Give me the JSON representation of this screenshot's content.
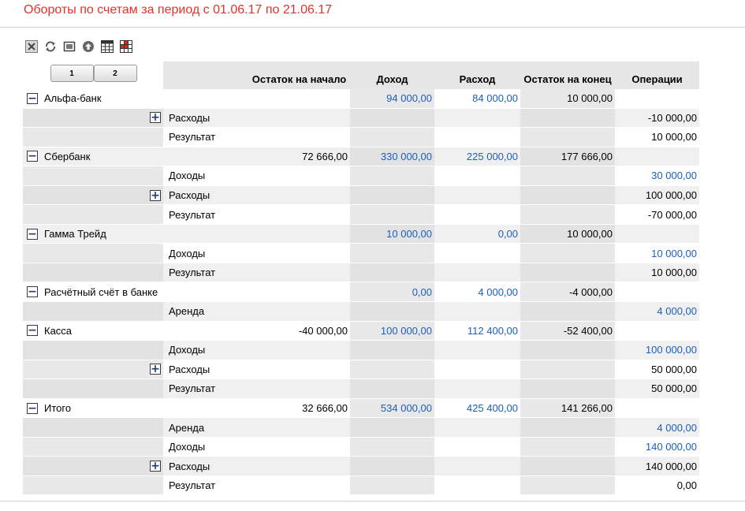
{
  "title": "Обороты по счетам за период с 01.06.17 по 21.06.17",
  "toolbar": [
    "close-icon",
    "refresh-icon",
    "fit-icon",
    "upload-icon",
    "table-icon",
    "table-red-icon"
  ],
  "colors": {
    "title": "#e2322b",
    "link": "#1b5fbf",
    "header_bg": "#e6e6e6",
    "row_shade": "#f0f0f0",
    "col_shade": "#e8e8e8"
  },
  "levels": [
    "1",
    "2"
  ],
  "headers": [
    "Остаток на начало",
    "Доход",
    "Расход",
    "Остаток на конец",
    "Операции"
  ],
  "rows": [
    {
      "group": "Альфа-банк",
      "sub": "",
      "toggle": "−",
      "c1": "",
      "c2": "94 000,00",
      "c3": "84 000,00",
      "c4": "10 000,00",
      "c5": ""
    },
    {
      "group": "",
      "sub": "Расходы",
      "toggle": "+",
      "c1": "",
      "c2": "",
      "c3": "",
      "c4": "",
      "c5": "-10 000,00"
    },
    {
      "group": "",
      "sub": "Результат",
      "toggle": "",
      "c1": "",
      "c2": "",
      "c3": "",
      "c4": "",
      "c5": "10 000,00"
    },
    {
      "group": "Сбербанк",
      "sub": "",
      "toggle": "−",
      "c1": "72 666,00",
      "c2": "330 000,00",
      "c3": "225 000,00",
      "c4": "177 666,00",
      "c5": ""
    },
    {
      "group": "",
      "sub": "Доходы",
      "toggle": "",
      "c1": "",
      "c2": "",
      "c3": "",
      "c4": "",
      "c5": "30 000,00"
    },
    {
      "group": "",
      "sub": "Расходы",
      "toggle": "+",
      "c1": "",
      "c2": "",
      "c3": "",
      "c4": "",
      "c5": "100 000,00"
    },
    {
      "group": "",
      "sub": "Результат",
      "toggle": "",
      "c1": "",
      "c2": "",
      "c3": "",
      "c4": "",
      "c5": "-70 000,00"
    },
    {
      "group": "Гамма Трейд",
      "sub": "",
      "toggle": "−",
      "c1": "",
      "c2": "10 000,00",
      "c3": "0,00",
      "c4": "10 000,00",
      "c5": ""
    },
    {
      "group": "",
      "sub": "Доходы",
      "toggle": "",
      "c1": "",
      "c2": "",
      "c3": "",
      "c4": "",
      "c5": "10 000,00"
    },
    {
      "group": "",
      "sub": "Результат",
      "toggle": "",
      "c1": "",
      "c2": "",
      "c3": "",
      "c4": "",
      "c5": "10 000,00"
    },
    {
      "group": "Расчётный счёт в банке",
      "sub": "",
      "toggle": "−",
      "c1": "",
      "c2": "0,00",
      "c3": "4 000,00",
      "c4": "-4 000,00",
      "c5": ""
    },
    {
      "group": "",
      "sub": "Аренда",
      "toggle": "",
      "c1": "",
      "c2": "",
      "c3": "",
      "c4": "",
      "c5": "4 000,00"
    },
    {
      "group": "Касса",
      "sub": "",
      "toggle": "−",
      "c1": "-40 000,00",
      "c2": "100 000,00",
      "c3": "112 400,00",
      "c4": "-52 400,00",
      "c5": ""
    },
    {
      "group": "",
      "sub": "Доходы",
      "toggle": "",
      "c1": "",
      "c2": "",
      "c3": "",
      "c4": "",
      "c5": "100 000,00"
    },
    {
      "group": "",
      "sub": "Расходы",
      "toggle": "+",
      "c1": "",
      "c2": "",
      "c3": "",
      "c4": "",
      "c5": "50 000,00"
    },
    {
      "group": "",
      "sub": "Результат",
      "toggle": "",
      "c1": "",
      "c2": "",
      "c3": "",
      "c4": "",
      "c5": "50 000,00"
    },
    {
      "group": "Итого",
      "sub": "",
      "toggle": "−",
      "c1": "32 666,00",
      "c2": "534 000,00",
      "c3": "425 400,00",
      "c4": "141 266,00",
      "c5": ""
    },
    {
      "group": "",
      "sub": "Аренда",
      "toggle": "",
      "c1": "",
      "c2": "",
      "c3": "",
      "c4": "",
      "c5": "4 000,00"
    },
    {
      "group": "",
      "sub": "Доходы",
      "toggle": "",
      "c1": "",
      "c2": "",
      "c3": "",
      "c4": "",
      "c5": "140 000,00"
    },
    {
      "group": "",
      "sub": "Расходы",
      "toggle": "+",
      "c1": "",
      "c2": "",
      "c3": "",
      "c4": "",
      "c5": "140 000,00"
    },
    {
      "group": "",
      "sub": "Результат",
      "toggle": "",
      "c1": "",
      "c2": "",
      "c3": "",
      "c4": "",
      "c5": "0,00"
    }
  ],
  "blue_cols_group": [
    "c2",
    "c3"
  ],
  "blue_ops_rows": [
    4,
    8,
    11,
    13,
    17,
    18
  ]
}
